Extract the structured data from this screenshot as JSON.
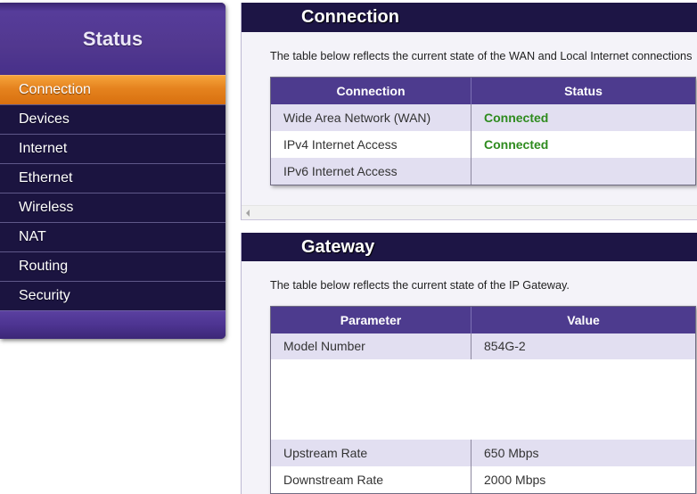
{
  "sidebar": {
    "title": "Status",
    "items": [
      {
        "label": "Connection",
        "active": true
      },
      {
        "label": "Devices",
        "active": false
      },
      {
        "label": "Internet",
        "active": false
      },
      {
        "label": "Ethernet",
        "active": false
      },
      {
        "label": "Wireless",
        "active": false
      },
      {
        "label": "NAT",
        "active": false
      },
      {
        "label": "Routing",
        "active": false
      },
      {
        "label": "Security",
        "active": false
      }
    ]
  },
  "connection_panel": {
    "title": "Connection",
    "description": "The table below reflects the current state of the WAN and Local Internet connections",
    "columns": [
      "Connection",
      "Status"
    ],
    "rows": [
      {
        "connection": "Wide Area Network (WAN)",
        "status": "Connected"
      },
      {
        "connection": "IPv4 Internet Access",
        "status": "Connected"
      },
      {
        "connection": "IPv6 Internet Access",
        "status": ""
      }
    ]
  },
  "gateway_panel": {
    "title": "Gateway",
    "description": "The table below reflects the current state of the IP Gateway.",
    "columns": [
      "Parameter",
      "Value"
    ],
    "rows": [
      {
        "parameter": "Model Number",
        "value": "854G-2"
      },
      {
        "parameter": "Upstream Rate",
        "value": "650 Mbps"
      },
      {
        "parameter": "Downstream Rate",
        "value": "2000 Mbps"
      }
    ]
  },
  "colors": {
    "nav_bg": "#1b1440",
    "sidebar_purple": "#52388f",
    "accent_orange": "#e5821e",
    "panel_header": "#1d1545",
    "panel_body": "#f4f3f9",
    "table_header": "#4d3b8e",
    "row_alt": "#e2dff1",
    "status_green": "#2e8b1e"
  },
  "icons": {
    "scrollbar_left": "scroll-left-arrow-icon"
  }
}
